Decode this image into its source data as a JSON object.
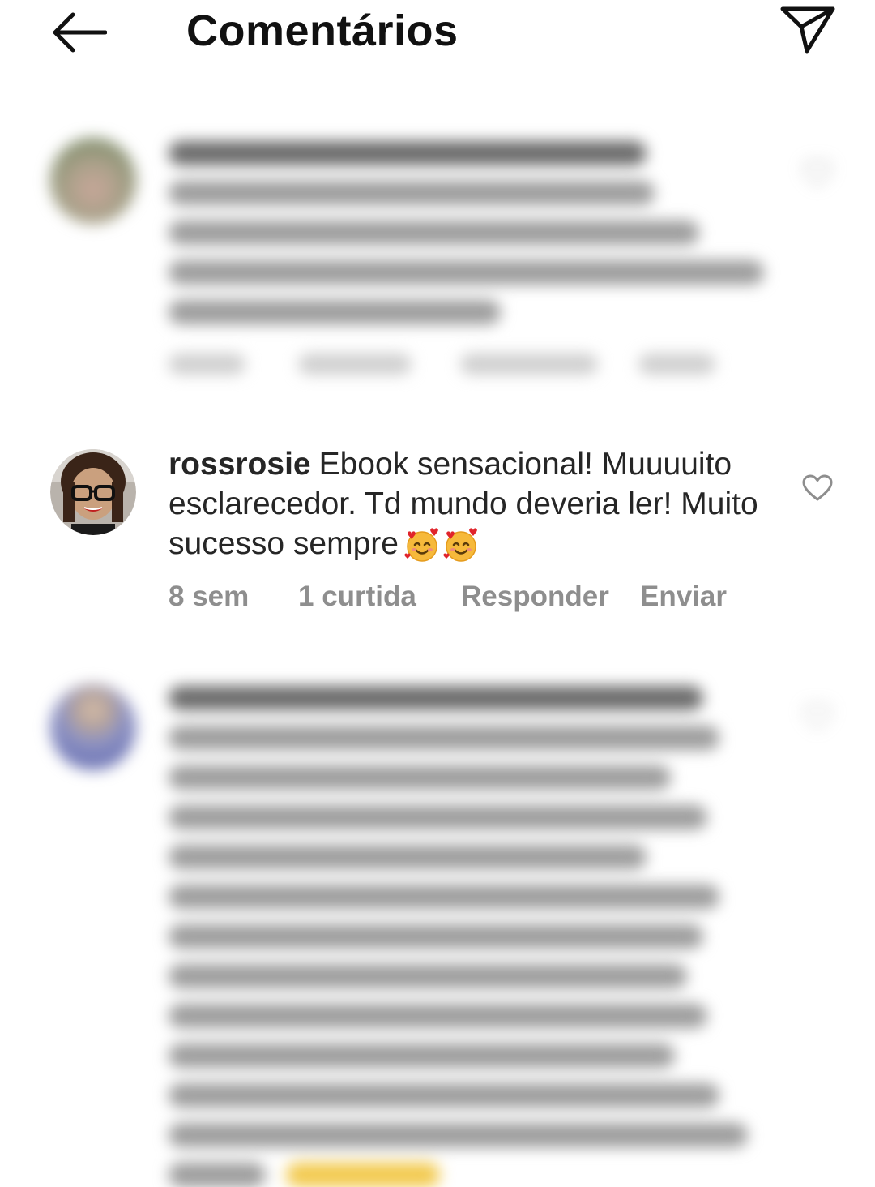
{
  "header": {
    "title": "Comentários",
    "back_icon": "arrow-left-icon",
    "share_icon": "paper-plane-icon"
  },
  "comments": [
    {
      "blurred": true,
      "avatar_icon": "avatar-photo"
    },
    {
      "blurred": false,
      "username": "rossrosie",
      "text": "Ebook sensacional! Muuuuito esclarecedor. Td mundo deveria ler! Muito sucesso sempre",
      "emoji": "🥰🥰",
      "time": "8 sem",
      "likes": "1 curtida",
      "reply_label": "Responder",
      "send_label": "Enviar",
      "like_icon": "heart-outline-icon"
    },
    {
      "blurred": true,
      "avatar_icon": "avatar-photo"
    }
  ],
  "colors": {
    "text": "#262626",
    "muted": "#8e8e8e",
    "background": "#ffffff"
  }
}
